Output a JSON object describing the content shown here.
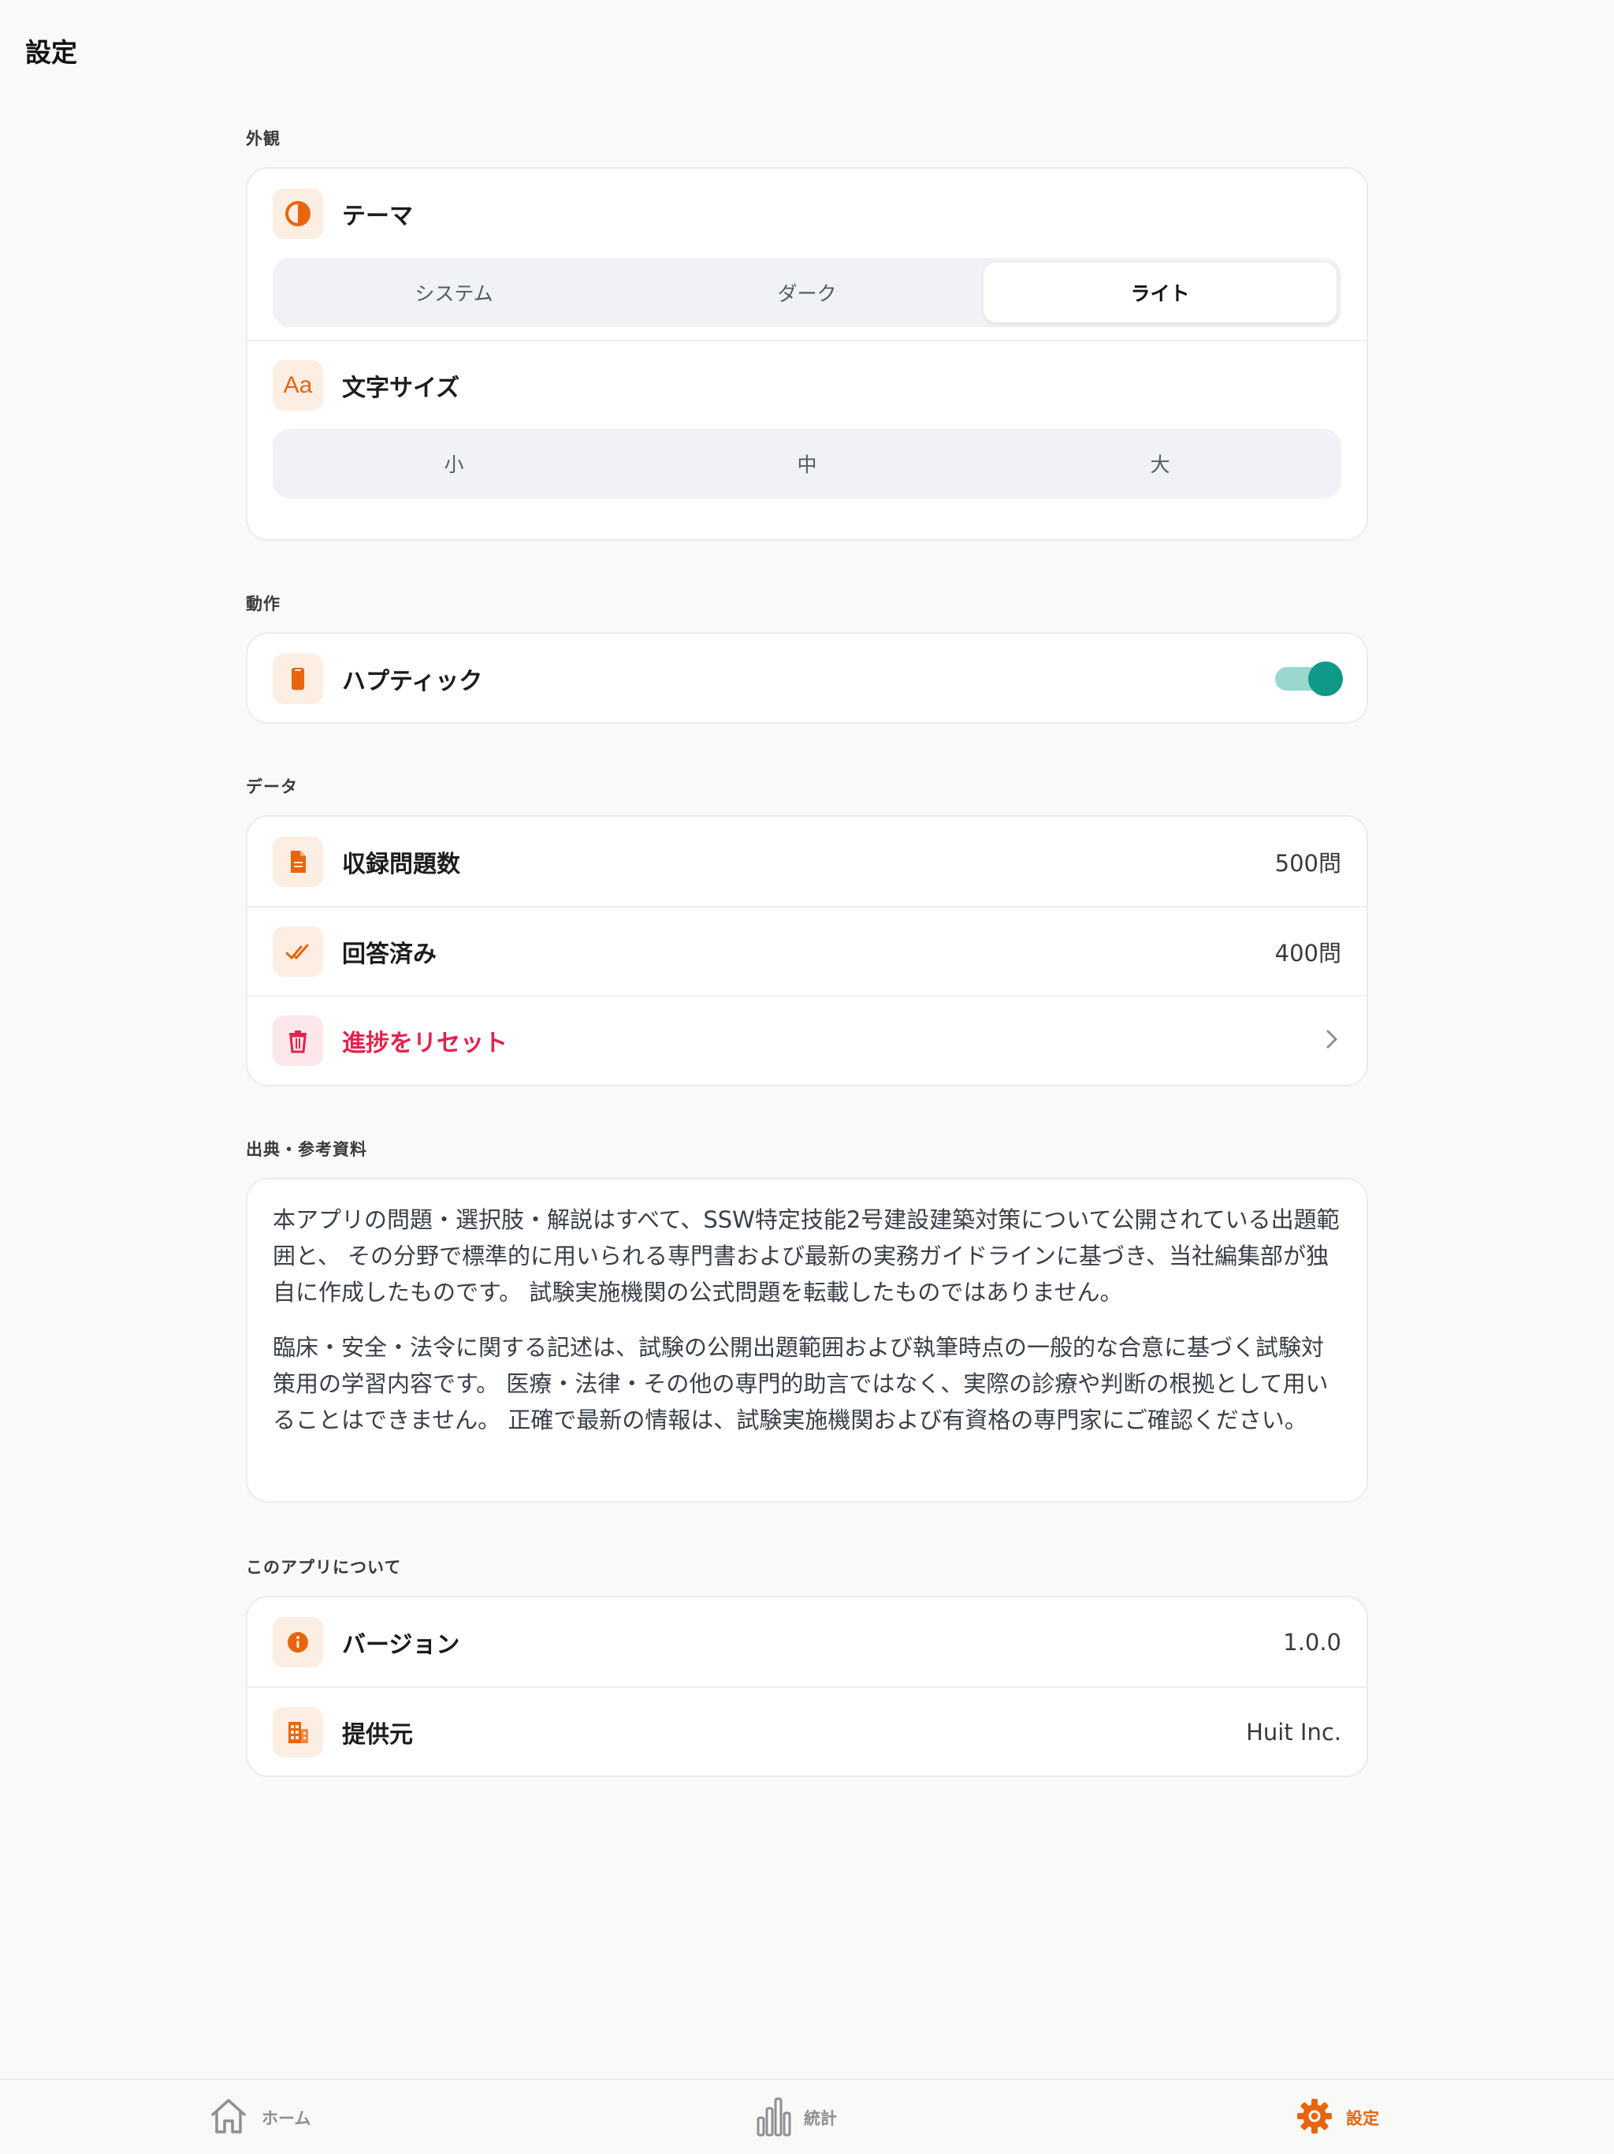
{
  "page_title": "設定",
  "sections": {
    "appearance": {
      "label": "外観",
      "theme": {
        "label": "テーマ",
        "options": [
          "システム",
          "ダーク",
          "ライト"
        ],
        "selected": "ライト"
      },
      "font_size": {
        "label": "文字サイズ",
        "options": [
          "小",
          "中",
          "大"
        ],
        "selected": ""
      }
    },
    "behavior": {
      "label": "動作",
      "haptics": {
        "label": "ハプティック",
        "enabled": true
      }
    },
    "data": {
      "label": "データ",
      "total_questions": {
        "label": "収録問題数",
        "value": "500問"
      },
      "answered": {
        "label": "回答済み",
        "value": "400問"
      },
      "reset": {
        "label": "進捗をリセット"
      }
    },
    "sources": {
      "label": "出典・参考資料",
      "paragraph1": "本アプリの問題・選択肢・解説はすべて、SSW特定技能2号建設建築対策について公開されている出題範囲と、 その分野で標準的に用いられる専門書および最新の実務ガイドラインに基づき、当社編集部が独自に作成したものです。 試験実施機関の公式問題を転載したものではありません。",
      "paragraph2": "臨床・安全・法令に関する記述は、試験の公開出題範囲および執筆時点の一般的な合意に基づく試験対策用の学習内容です。 医療・法律・その他の専門的助言ではなく、実際の診療や判断の根拠として用いることはできません。 正確で最新の情報は、試験実施機関および有資格の専門家にご確認ください。"
    },
    "about": {
      "label": "このアプリについて",
      "version": {
        "label": "バージョン",
        "value": "1.0.0"
      },
      "provider": {
        "label": "提供元",
        "value": "Huit Inc."
      }
    }
  },
  "tabbar": {
    "home": "ホーム",
    "stats": "統計",
    "settings": "設定"
  },
  "colors": {
    "accent": "#e8650e",
    "danger": "#e0244e",
    "toggle_on": "#0f9a87",
    "background": "#f9f9f8"
  },
  "icons": {
    "theme": "half-circle-icon",
    "font_size": "text-size-icon",
    "haptics": "phone-icon",
    "total_questions": "document-icon",
    "answered": "double-check-icon",
    "reset": "trash-icon",
    "version": "info-icon",
    "provider": "building-icon",
    "home": "home-icon",
    "stats": "bar-chart-icon",
    "settings": "gear-icon"
  }
}
